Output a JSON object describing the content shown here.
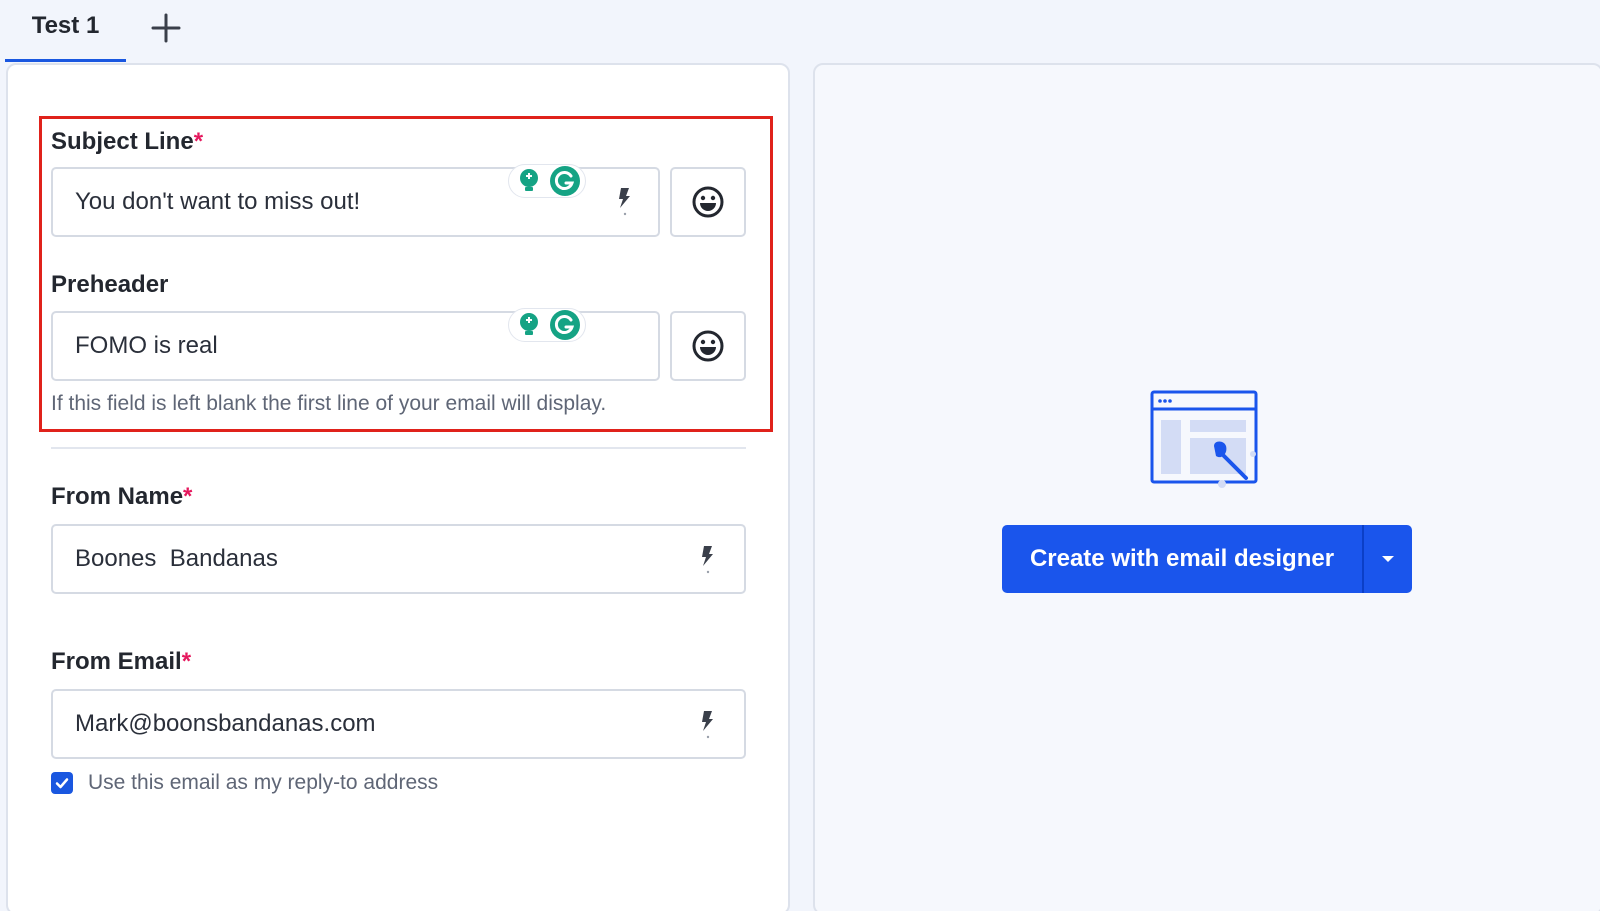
{
  "tabs": [
    {
      "label": "Test 1",
      "active": true
    }
  ],
  "add_tab_icon": "plus-icon",
  "subject_line": {
    "label": "Subject Line",
    "required_mark": "*",
    "value": "You don't want to miss out!"
  },
  "preheader": {
    "label": "Preheader",
    "value": "FOMO is real",
    "helper": "If this field is left blank the first line of your email will display."
  },
  "from_name": {
    "label": "From Name",
    "required_mark": "*",
    "value": "Boones  Bandanas"
  },
  "from_email": {
    "label": "From Email",
    "required_mark": "*",
    "value": "Mark@boonsbandanas.com"
  },
  "reply_to": {
    "label": "Use this email as my reply-to address",
    "checked": true
  },
  "cta": {
    "label": "Create with email designer"
  },
  "colors": {
    "accent": "#1a55ec",
    "required": "#e5195e",
    "highlight": "#e0221b",
    "grammarly_green": "#15a384"
  }
}
